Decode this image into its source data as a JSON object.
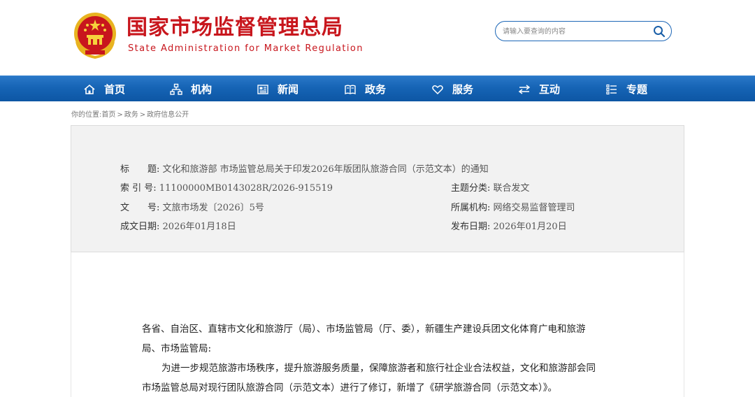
{
  "header": {
    "title_cn": "国家市场监督管理总局",
    "title_en": "State Administration for Market Regulation",
    "emblem_icon": "national-emblem-icon",
    "brand_color": "#c8161d"
  },
  "search": {
    "placeholder": "请输入要查询的内容",
    "icon": "search-icon"
  },
  "nav": {
    "items": [
      {
        "label": "首页",
        "icon": "home-icon"
      },
      {
        "label": "机构",
        "icon": "org-chart-icon"
      },
      {
        "label": "新闻",
        "icon": "newspaper-icon"
      },
      {
        "label": "政务",
        "icon": "book-icon"
      },
      {
        "label": "服务",
        "icon": "heart-icon"
      },
      {
        "label": "互动",
        "icon": "exchange-arrows-icon"
      },
      {
        "label": "专题",
        "icon": "list-icon"
      }
    ],
    "color": "#1664b5"
  },
  "breadcrumb": {
    "prefix": "你的位置:",
    "items": [
      "首页",
      "政务",
      "政府信息公开"
    ],
    "separator": ">"
  },
  "info": {
    "title_label": "标　　题:",
    "title_value": "文化和旅游部 市场监管总局关于印发2026年版团队旅游合同（示范文本）的通知",
    "index_label": "索 引 号:",
    "index_value": "11100000MB0143028R/2026-915519",
    "category_label": "主题分类:",
    "category_value": "联合发文",
    "doc_no_label": "文　　号:",
    "doc_no_value": "文旅市场发〔2026〕5号",
    "org_label": "所属机构:",
    "org_value": "网络交易监督管理司",
    "created_label": "成文日期:",
    "created_value": "2026年01月18日",
    "published_label": "发布日期:",
    "published_value": "2026年01月20日"
  },
  "content": {
    "salutation_line1": "各省、自治区、直辖市文化和旅游厅（局）、市场监管局（厅、委），新疆生产建设兵团文化体育广电和旅游",
    "salutation_line2": "局、市场监管局:",
    "para1_line1": "为进一步规范旅游市场秩序，提升旅游服务质量，保障旅游者和旅行社企业合法权益，文化和旅游部会同",
    "para1_line2": "市场监管总局对现行团队旅游合同（示范文本）进行了修订，新增了《研学旅游合同（示范文本）》。"
  }
}
